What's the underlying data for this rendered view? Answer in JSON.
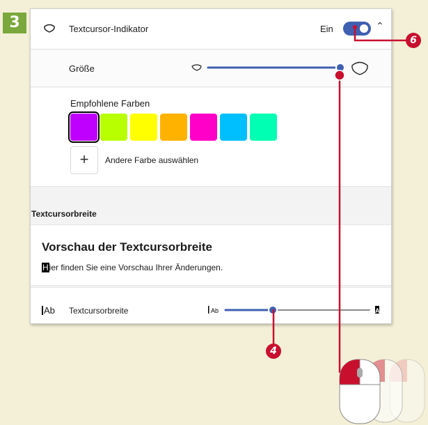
{
  "step": {
    "number": "3"
  },
  "indicator": {
    "icon": "cursor-indicator-icon",
    "label": "Textcursor-Indikator",
    "state_label": "Ein",
    "toggle_on": true,
    "chevron_icon": "chevron-up-icon"
  },
  "size": {
    "label": "Größe",
    "slider_value": 1.0
  },
  "colors": {
    "title": "Empfohlene Farben",
    "swatches": [
      "#bf00ff",
      "#b8ff00",
      "#ffff00",
      "#ffb300",
      "#ff00c8",
      "#00bfff",
      "#00ffb3"
    ],
    "selected_index": 0,
    "other_label": "Andere Farbe auswählen",
    "other_icon": "plus-icon"
  },
  "width_section": {
    "heading": "Textcursorbreite",
    "preview_title": "Vorschau der Textcursorbreite",
    "preview_first_char": "H",
    "preview_rest": "ier finden Sie eine Vorschau Ihrer Änderungen.",
    "row_label": "Textcursorbreite",
    "row_icon_text": "Ab",
    "slider_min_text": "Ab",
    "slider_max_text": "Ab",
    "slider_value": 0.3
  },
  "callouts": {
    "toggle": "6",
    "width_slider": "4"
  },
  "accent": "#3f5fb0",
  "callout_color": "#c8102e"
}
